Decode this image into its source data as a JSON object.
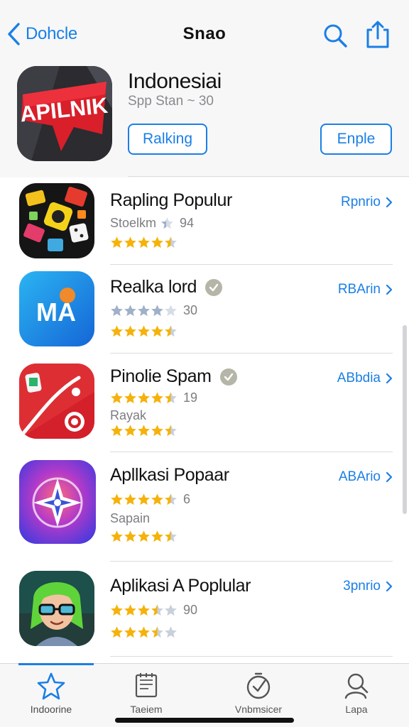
{
  "nav": {
    "back_label": "Dohcle",
    "title": "Snao",
    "icons": [
      "chevron-left-icon",
      "search-icon",
      "share-icon"
    ],
    "accent": "#1a7fe6"
  },
  "hero": {
    "icon_text": "APILNIK",
    "name": "Indonesiai",
    "subtitle": "Spp Stan ~ 30",
    "button_left": "Ralking",
    "button_right": "Enple"
  },
  "apps": [
    {
      "name": "Rapling Populur",
      "line1_text": "Stoelkm",
      "line1_rating": 0.4,
      "line1_suffix": "94",
      "rating_row": 4.5,
      "action": "Rpnrio",
      "verified": false
    },
    {
      "name": "Realka lord",
      "line1_text": "",
      "line1_rating": 4.0,
      "line1_suffix": "30",
      "rating_row": 4.5,
      "action": "RBArin",
      "verified": true,
      "icon_text": "MA"
    },
    {
      "name": "Pinolie Spam",
      "line1_text": "",
      "line1_rating": 4.5,
      "line1_suffix": "19",
      "line2_text": "Rayak",
      "rating_row": 4.5,
      "action": "ABbdia",
      "verified": true
    },
    {
      "name": "Apllkasi Popaar",
      "line1_text": "",
      "line1_rating": 4.5,
      "line1_suffix": "6",
      "line2_text": "Sapain",
      "rating_row": 4.5,
      "action": "ABArio",
      "verified": false
    },
    {
      "name": "Aplikasi A Poplular",
      "line1_text": "",
      "line1_rating": 3.5,
      "line1_suffix": "90",
      "rating_row": 3.5,
      "action": "3pnrio",
      "verified": false
    }
  ],
  "tabs": [
    {
      "label": "Indoorine",
      "icon": "star-icon",
      "active": true
    },
    {
      "label": "Taeiem",
      "icon": "notepad-icon",
      "active": false
    },
    {
      "label": "Vnbmsicer",
      "icon": "clock-icon",
      "active": false
    },
    {
      "label": "Lapa",
      "icon": "person-search-icon",
      "active": false
    }
  ],
  "colors": {
    "star_fill": "#f5b20a",
    "star_empty": "#c8d0dc",
    "link": "#1a7fe6"
  }
}
